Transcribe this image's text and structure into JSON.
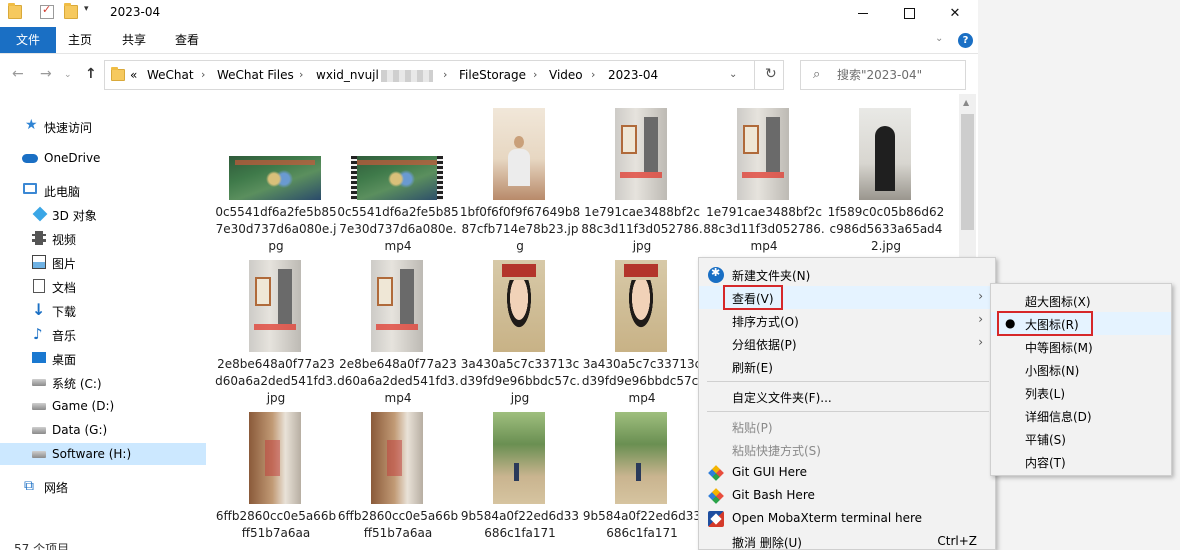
{
  "window": {
    "title": "2023-04"
  },
  "ribbon": {
    "tabs": [
      "文件",
      "主页",
      "共享",
      "查看"
    ]
  },
  "address": {
    "segments": [
      "«",
      "WeChat",
      "WeChat Files",
      "wxid_nvujl",
      "FileStorage",
      "Video",
      "2023-04"
    ]
  },
  "search": {
    "placeholder": "搜索\"2023-04\""
  },
  "sidebar": {
    "items": [
      {
        "label": "快速访问",
        "icon": "star-icon"
      },
      {
        "label": "OneDrive",
        "icon": "cloud-icon"
      },
      {
        "label": "此电脑",
        "icon": "computer-icon"
      },
      {
        "label": "3D 对象",
        "icon": "cube-icon"
      },
      {
        "label": "视频",
        "icon": "film-icon"
      },
      {
        "label": "图片",
        "icon": "picture-icon"
      },
      {
        "label": "文档",
        "icon": "document-icon"
      },
      {
        "label": "下载",
        "icon": "download-icon"
      },
      {
        "label": "音乐",
        "icon": "music-icon"
      },
      {
        "label": "桌面",
        "icon": "desktop-icon"
      },
      {
        "label": "系统 (C:)",
        "icon": "drive-icon"
      },
      {
        "label": "Game (D:)",
        "icon": "drive-icon"
      },
      {
        "label": "Data (G:)",
        "icon": "drive-icon"
      },
      {
        "label": "Software (H:)",
        "icon": "drive-icon"
      },
      {
        "label": "网络",
        "icon": "network-icon"
      }
    ],
    "status": "57 个项目"
  },
  "files": [
    {
      "name": "0c5541df6a2fe5b857e30d737d6a080e.jpg",
      "thumb": "game"
    },
    {
      "name": "0c5541df6a2fe5b857e30d737d6a080e.mp4",
      "thumb": "game-video"
    },
    {
      "name": "1bf0f6f0f9f67649b887cfb714e78b23.jpg",
      "thumb": "person"
    },
    {
      "name": "1e791cae3488bf2c88c3d11f3d052786.jpg",
      "thumb": "room"
    },
    {
      "name": "1e791cae3488bf2c88c3d11f3d052786.mp4",
      "thumb": "room"
    },
    {
      "name": "1f589c0c05b86d62c986d5633a65ad42.jpg",
      "thumb": "dark"
    },
    {
      "name": "2e8be648a0f77a23d60a6a2ded541fd3.jpg",
      "thumb": "room"
    },
    {
      "name": "2e8be648a0f77a23d60a6a2ded541fd3.mp4",
      "thumb": "room"
    },
    {
      "name": "3a430a5c7c33713cd39fd9e96bbdc57c.jpg",
      "thumb": "face"
    },
    {
      "name": "3a430a5c7c33713cd39fd9e96bbdc57c.mp4",
      "thumb": "face"
    },
    {
      "name": "6ffb2860cc0e5a66bff51b7a6aa",
      "thumb": "closet"
    },
    {
      "name": "6ffb2860cc0e5a66bff51b7a6aa",
      "thumb": "closet"
    },
    {
      "name": "9b584a0f22ed6d33686c1fa171",
      "thumb": "park"
    },
    {
      "name": "9b584a0f22ed6d33686c1fa171",
      "thumb": "park"
    }
  ],
  "context_menu": {
    "items": [
      {
        "label": "新建文件夹(N)",
        "icon": "new-folder-icon"
      },
      {
        "label": "查看(V)",
        "submenu": true
      },
      {
        "label": "排序方式(O)",
        "submenu": true
      },
      {
        "label": "分组依据(P)",
        "submenu": true
      },
      {
        "label": "刷新(E)"
      },
      {
        "label": "自定义文件夹(F)..."
      },
      {
        "label": "粘贴(P)",
        "disabled": true
      },
      {
        "label": "粘贴快捷方式(S)",
        "disabled": true
      },
      {
        "label": "Git GUI Here",
        "icon": "git-icon"
      },
      {
        "label": "Git Bash Here",
        "icon": "git-icon"
      },
      {
        "label": "Open MobaXterm terminal here",
        "icon": "mobaxterm-icon"
      },
      {
        "label": "撤消 删除(U)",
        "shortcut": "Ctrl+Z"
      }
    ]
  },
  "view_submenu": {
    "items": [
      {
        "label": "超大图标(X)"
      },
      {
        "label": "大图标(R)",
        "selected": true
      },
      {
        "label": "中等图标(M)"
      },
      {
        "label": "小图标(N)"
      },
      {
        "label": "列表(L)"
      },
      {
        "label": "详细信息(D)"
      },
      {
        "label": "平铺(S)"
      },
      {
        "label": "内容(T)"
      }
    ]
  },
  "colors": {
    "accent": "#1a6fc4",
    "highlight": "#cce8ff",
    "annotation": "#d6282a"
  }
}
